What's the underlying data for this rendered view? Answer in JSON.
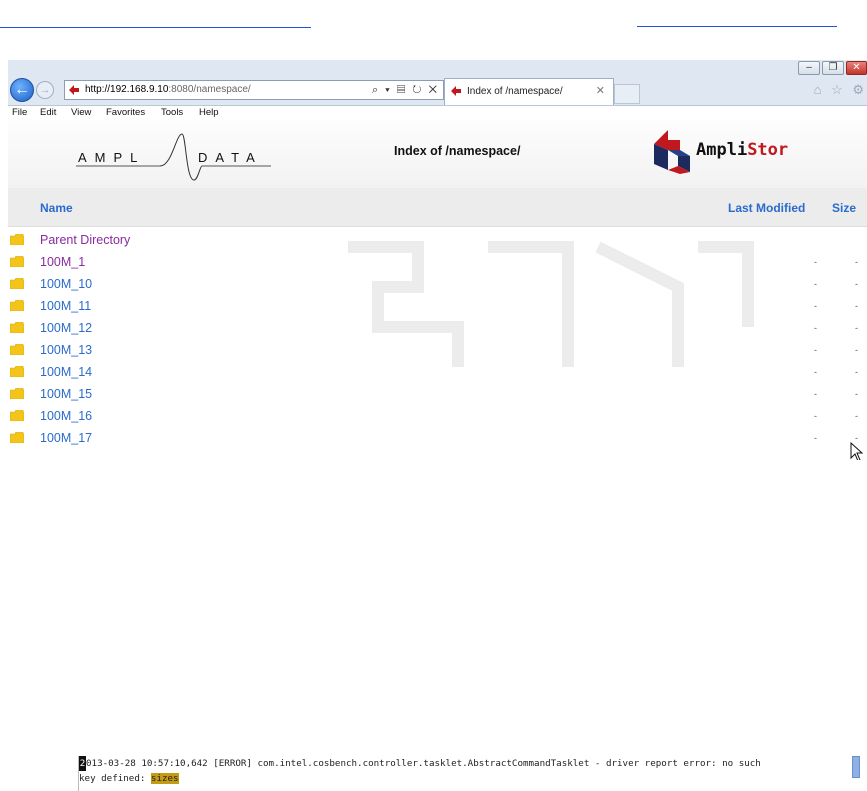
{
  "browser": {
    "url_host": "http://192.168.9.10",
    "url_rest": ":8080/namespace/",
    "address_tools": "⌕ ▾ ▤ ↻ ✕",
    "tab_title": "Index of /namespace/",
    "tab_close": "✕",
    "back_glyph": "←",
    "fwd_glyph": "→",
    "right_icons": "⌂ ☆ ⚙",
    "window_buttons": {
      "minimize": "–",
      "restore": "❐",
      "close": "✕"
    },
    "menu": [
      "File",
      "Edit",
      "View",
      "Favorites",
      "Tools",
      "Help"
    ]
  },
  "page": {
    "title": "Index of /namespace/",
    "amplidata_logo_text": "A M P L / I D A T A",
    "amplistor_logo_text_a": "Ampli",
    "amplistor_logo_text_b": "Stor",
    "columns": {
      "name": "Name",
      "last_modified": "Last Modified",
      "size": "Size"
    },
    "entries": [
      {
        "name": "Parent Directory",
        "visited": true,
        "modified": "",
        "size": ""
      },
      {
        "name": "100M_1",
        "visited": true,
        "modified": "-",
        "size": "-"
      },
      {
        "name": "100M_10",
        "visited": false,
        "modified": "-",
        "size": "-"
      },
      {
        "name": "100M_11",
        "visited": false,
        "modified": "-",
        "size": "-"
      },
      {
        "name": "100M_12",
        "visited": false,
        "modified": "-",
        "size": "-"
      },
      {
        "name": "100M_13",
        "visited": false,
        "modified": "-",
        "size": "-"
      },
      {
        "name": "100M_14",
        "visited": false,
        "modified": "-",
        "size": "-"
      },
      {
        "name": "100M_15",
        "visited": false,
        "modified": "-",
        "size": "-"
      },
      {
        "name": "100M_16",
        "visited": false,
        "modified": "-",
        "size": "-"
      },
      {
        "name": "100M_17",
        "visited": false,
        "modified": "-",
        "size": "-"
      }
    ]
  },
  "log": {
    "caret_char": "2",
    "line1_rest": "013-03-28 10:57:10,642 [ERROR] com.intel.cosbench.controller.tasklet.AbstractCommandTasklet - driver report error: no such",
    "line2_prefix": " key defined: ",
    "line2_highlight": "sizes"
  },
  "colors": {
    "link": "#2a6bcc",
    "visited_link": "#8a2aa0",
    "highlight": "#c49b12",
    "brand_red": "#c0181f"
  }
}
